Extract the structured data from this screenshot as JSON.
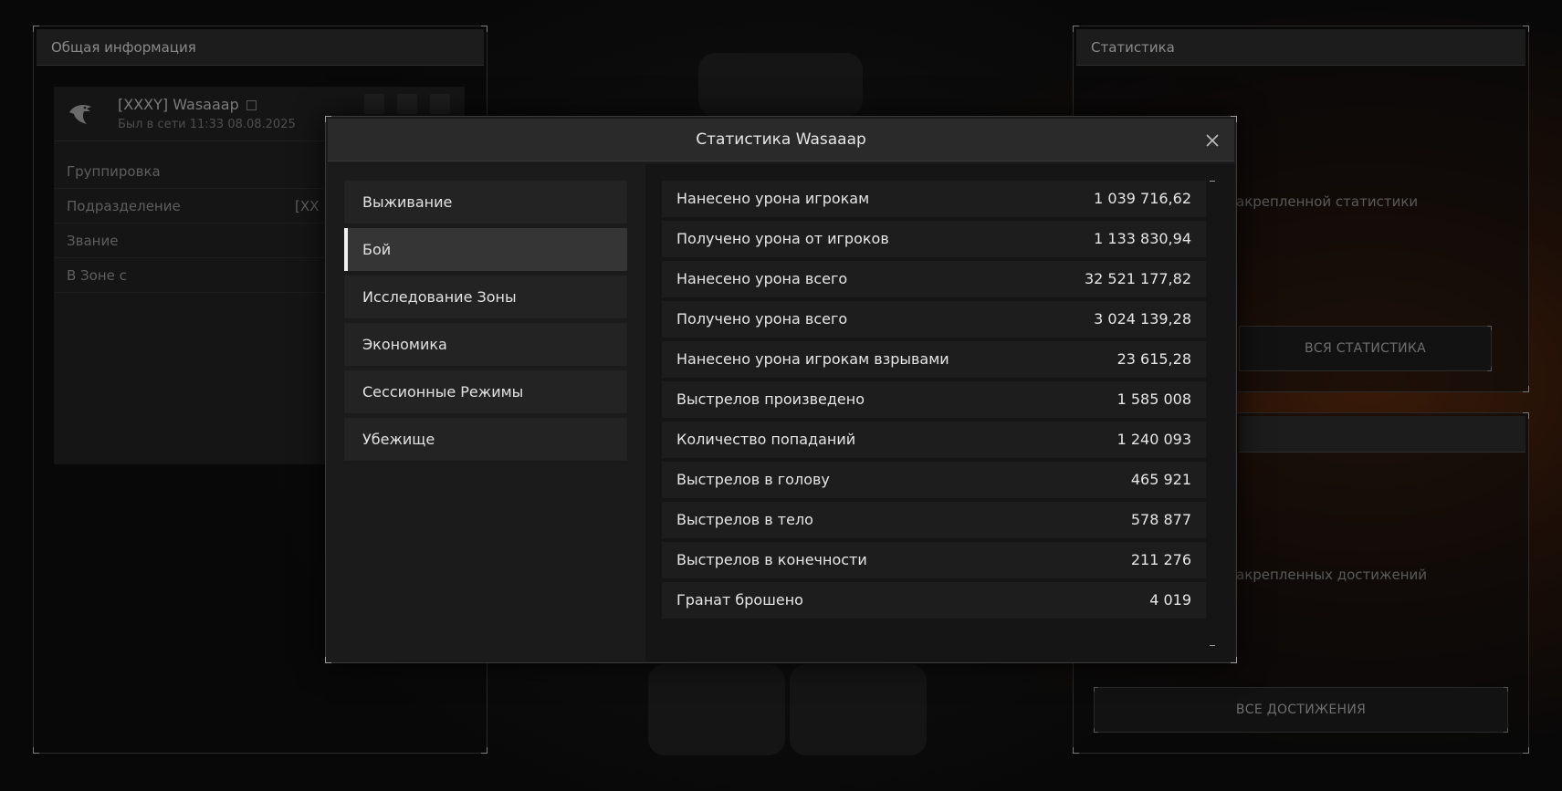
{
  "left_panel": {
    "title": "Общая информация",
    "profile": {
      "name": "[XXXY] Wasaaap",
      "online": "Был в сети 11:33 08.08.2025"
    },
    "rows": [
      {
        "label": "Группировка",
        "value": ""
      },
      {
        "label": "Подразделение",
        "value": "[XX"
      },
      {
        "label": "Звание",
        "value": ""
      },
      {
        "label": "В Зоне с",
        "value": ""
      }
    ]
  },
  "right_top_panel": {
    "title": "Статистика",
    "empty_text": "акрепленной статистики",
    "button_label": "ВСЯ СТАТИСТИКА"
  },
  "right_bottom_panel": {
    "empty_text": "акрепленных достижений",
    "button_label": "ВСЕ ДОСТИЖЕНИЯ"
  },
  "modal": {
    "title": "Статистика Wasaaap",
    "categories": [
      {
        "label": "Выживание",
        "active": false
      },
      {
        "label": "Бой",
        "active": true
      },
      {
        "label": "Исследование Зоны",
        "active": false
      },
      {
        "label": "Экономика",
        "active": false
      },
      {
        "label": "Сессионные Режимы",
        "active": false
      },
      {
        "label": "Убежище",
        "active": false
      }
    ],
    "stats": [
      {
        "label": "Нанесено урона игрокам",
        "value": "1 039 716,62"
      },
      {
        "label": "Получено урона от игроков",
        "value": "1 133 830,94"
      },
      {
        "label": "Нанесено урона всего",
        "value": "32 521 177,82"
      },
      {
        "label": "Получено урона всего",
        "value": "3 024 139,28"
      },
      {
        "label": "Нанесено урона игрокам взрывами",
        "value": "23 615,28"
      },
      {
        "label": "Выстрелов произведено",
        "value": "1 585 008"
      },
      {
        "label": "Количество попаданий",
        "value": "1 240 093"
      },
      {
        "label": "Выстрелов в голову",
        "value": "465 921"
      },
      {
        "label": "Выстрелов в тело",
        "value": "578 877"
      },
      {
        "label": "Выстрелов в конечности",
        "value": "211 276"
      },
      {
        "label": "Гранат брошено",
        "value": "4 019"
      }
    ]
  },
  "icons": {
    "close": "close-icon",
    "eagle": "eagle-icon",
    "copy": "copy-icon"
  },
  "colors": {
    "active_indicator": "#f0f0f0",
    "modal_bg": "#1b1b1b",
    "row_bg": "#1d1d1d"
  }
}
